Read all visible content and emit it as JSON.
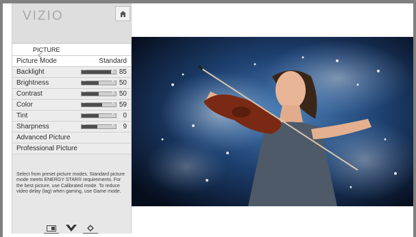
{
  "brand": {
    "logo": "VIZIO"
  },
  "menu": {
    "section_title": "PICTURE",
    "picture_mode": {
      "label": "Picture Mode",
      "value": "Standard"
    },
    "sliders": [
      {
        "label": "Backlight",
        "value": "85",
        "level": 0.85
      },
      {
        "label": "Brightness",
        "value": "50",
        "level": 0.5
      },
      {
        "label": "Contrast",
        "value": "50",
        "level": 0.5
      },
      {
        "label": "Color",
        "value": "59",
        "level": 0.59
      },
      {
        "label": "Tint",
        "value": "0",
        "level": 0.5
      },
      {
        "label": "Sharpness",
        "value": "9",
        "level": 0.45
      }
    ],
    "advanced": "Advanced Picture",
    "professional": "Professional Picture",
    "help": "Select from preset picture modes. Standard picture mode meets ENERGY STAR® requirements. For the best picture, use Calibrated mode. To reduce video delay (lag) when gaming, use Game mode."
  },
  "icons": {
    "home": "home-icon",
    "back": "back-arrow-icon",
    "input": "input-icon",
    "vizio_v": "vizio-v-icon",
    "settings": "gear-icon"
  },
  "colors": {
    "menu_bg": "#e7e7e7",
    "slider_fill": "#4d4d4d",
    "frame": "#808080"
  }
}
